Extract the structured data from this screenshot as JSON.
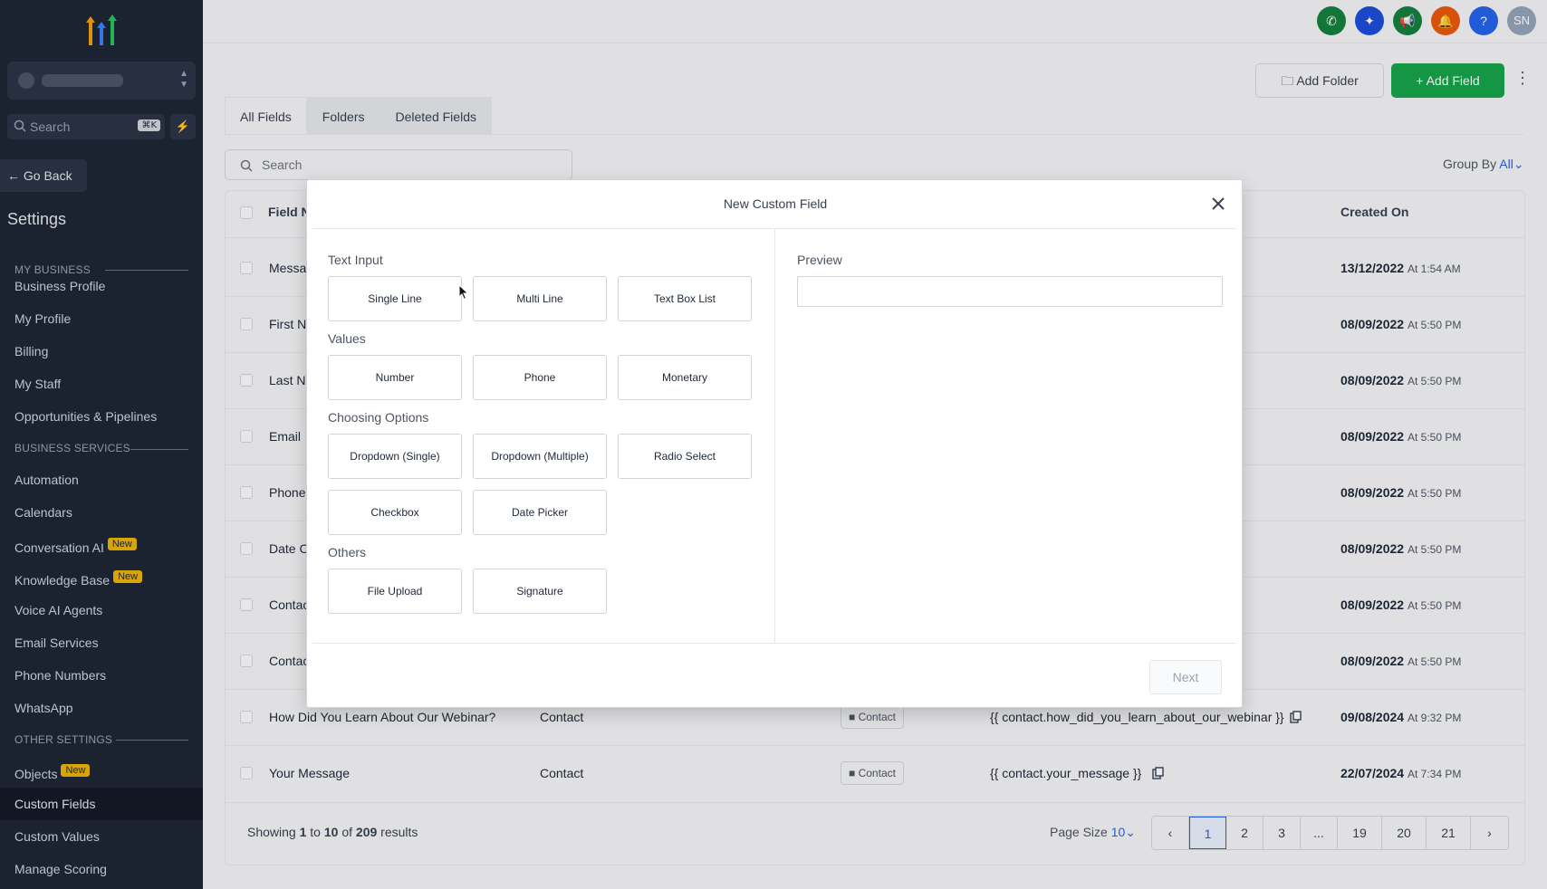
{
  "sidebar": {
    "search_placeholder": "Search",
    "search_shortcut": "⌘K",
    "go_back": "Go Back",
    "title": "Settings",
    "sections": {
      "my_business": "MY BUSINESS",
      "business_services": "BUSINESS SERVICES",
      "other_settings": "OTHER SETTINGS"
    },
    "items": {
      "business_profile": "Business Profile",
      "my_profile": "My Profile",
      "billing": "Billing",
      "my_staff": "My Staff",
      "opportunities": "Opportunities & Pipelines",
      "automation": "Automation",
      "calendars": "Calendars",
      "conversation_ai": "Conversation AI",
      "knowledge_base": "Knowledge Base",
      "voice_ai": "Voice AI Agents",
      "email_services": "Email Services",
      "phone_numbers": "Phone Numbers",
      "whatsapp": "WhatsApp",
      "objects": "Objects",
      "custom_fields": "Custom Fields",
      "custom_values": "Custom Values",
      "manage_scoring": "Manage Scoring"
    },
    "badge_new": "New"
  },
  "topbar": {
    "avatar_initials": "SN",
    "help": "?"
  },
  "toolbar": {
    "add_folder": "Add Folder",
    "add_field": "+ Add Field"
  },
  "tabs": [
    "All Fields",
    "Folders",
    "Deleted Fields"
  ],
  "search_placeholder": "Search",
  "group_by": {
    "label": "Group By",
    "value": "All"
  },
  "table": {
    "headers": {
      "field_name": "Field N",
      "created_on": "Created On"
    },
    "rows": [
      {
        "name": "Messa",
        "date": "13/12/2022",
        "time": "At 1:54 AM"
      },
      {
        "name": "First N",
        "date": "08/09/2022",
        "time": "At 5:50 PM"
      },
      {
        "name": "Last N",
        "date": "08/09/2022",
        "time": "At 5:50 PM"
      },
      {
        "name": "Email",
        "date": "08/09/2022",
        "time": "At 5:50 PM"
      },
      {
        "name": "Phone",
        "date": "08/09/2022",
        "time": "At 5:50 PM"
      },
      {
        "name": "Date C",
        "date": "08/09/2022",
        "time": "At 5:50 PM"
      },
      {
        "name": "Contac",
        "date": "08/09/2022",
        "time": "At 5:50 PM"
      },
      {
        "name": "Contac",
        "date": "08/09/2022",
        "time": "At 5:50 PM"
      },
      {
        "name": "How Did You Learn About Our Webinar?",
        "object": "Contact",
        "folder": "Contact",
        "key": "{{ contact.how_did_you_learn_about_our_webinar }}",
        "date": "09/08/2024",
        "time": "At 9:32 PM"
      },
      {
        "name": "Your Message",
        "object": "Contact",
        "folder": "Contact",
        "key": "{{ contact.your_message }}",
        "date": "22/07/2024",
        "time": "At 7:34 PM"
      }
    ]
  },
  "footer": {
    "showing_prefix": "Showing",
    "from": "1",
    "to_word": "to",
    "to": "10",
    "of_word": "of",
    "total": "209",
    "results_word": "results",
    "page_size_label": "Page Size",
    "page_size_value": "10",
    "pages": [
      "1",
      "2",
      "3",
      "...",
      "19",
      "20",
      "21"
    ],
    "current_page": "1"
  },
  "modal": {
    "title": "New Custom Field",
    "groups": {
      "text_input": "Text Input",
      "values": "Values",
      "choosing_options": "Choosing Options",
      "others": "Others"
    },
    "options": {
      "single_line": "Single Line",
      "multi_line": "Multi Line",
      "text_box_list": "Text Box List",
      "number": "Number",
      "phone": "Phone",
      "monetary": "Monetary",
      "dropdown_single": "Dropdown (Single)",
      "dropdown_multiple": "Dropdown (Multiple)",
      "radio_select": "Radio Select",
      "checkbox": "Checkbox",
      "date_picker": "Date Picker",
      "file_upload": "File Upload",
      "signature": "Signature"
    },
    "preview_label": "Preview",
    "next": "Next"
  },
  "colors": {
    "sidebar_bg": "#1e2535",
    "accent_green": "#16a34a",
    "accent_blue": "#2563eb",
    "badge_yellow": "#eab308"
  }
}
